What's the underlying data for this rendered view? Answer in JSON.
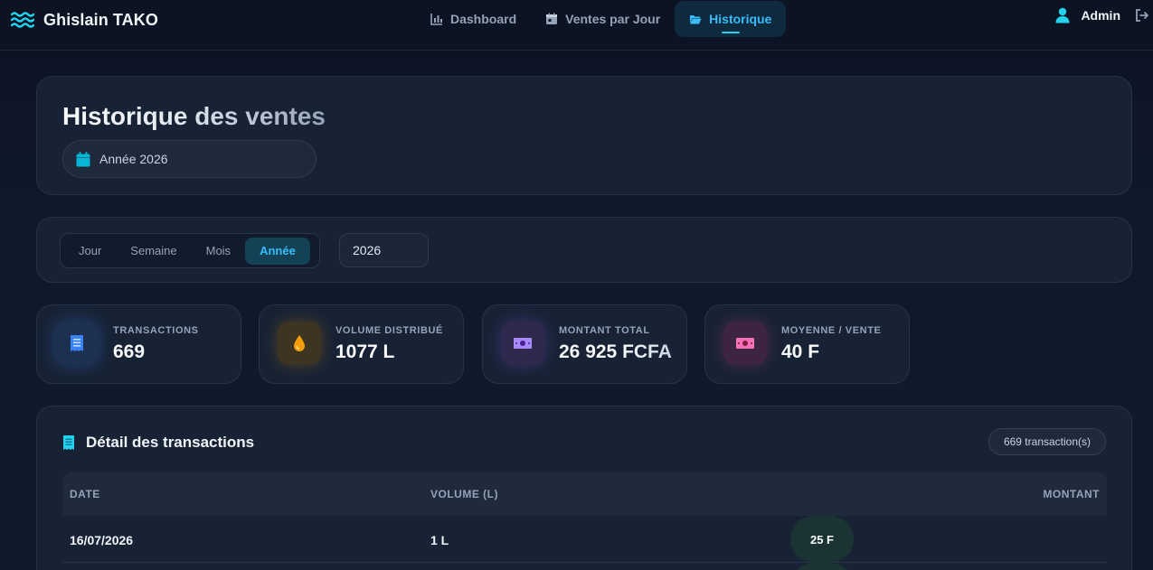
{
  "brand": {
    "name": "Ghislain TAKO",
    "icon": "waves-icon"
  },
  "nav": {
    "items": [
      {
        "label": "Dashboard",
        "icon": "bar-chart-icon",
        "active": false
      },
      {
        "label": "Ventes par Jour",
        "icon": "calendar-day-icon",
        "active": false
      },
      {
        "label": "Historique",
        "icon": "folder-open-icon",
        "active": true
      }
    ]
  },
  "user": {
    "name": "Admin",
    "icon": "user-icon",
    "logout_icon": "logout-icon"
  },
  "header": {
    "title": "Historique des ventes",
    "period_label": "Année 2026"
  },
  "filters": {
    "segments": [
      "Jour",
      "Semaine",
      "Mois",
      "Année"
    ],
    "active_segment": "Année",
    "year_value": "2026"
  },
  "stats": [
    {
      "label": "TRANSACTIONS",
      "value": "669",
      "icon": "receipt-icon",
      "color": "#3b82f6"
    },
    {
      "label": "VOLUME DISTRIBUÉ",
      "value": "1077 L",
      "icon": "droplet-icon",
      "color": "#f59e0b"
    },
    {
      "label": "MONTANT TOTAL",
      "value": "26 925 FCFA",
      "icon": "banknote-icon",
      "color": "#8b5cf6"
    },
    {
      "label": "MOYENNE / VENTE",
      "value": "40 F",
      "icon": "money-icon",
      "color": "#ec4899"
    }
  ],
  "table": {
    "title": "Détail des transactions",
    "count_badge": "669 transaction(s)",
    "columns": [
      "DATE",
      "VOLUME (L)",
      "MONTANT"
    ],
    "rows": [
      {
        "date": "16/07/2026",
        "volume": "1 L",
        "amount": "25 F"
      }
    ]
  },
  "colors": {
    "accent": "#22d3ee",
    "active_nav_bg": "#0f2a3f",
    "card_bg": "#172234"
  }
}
